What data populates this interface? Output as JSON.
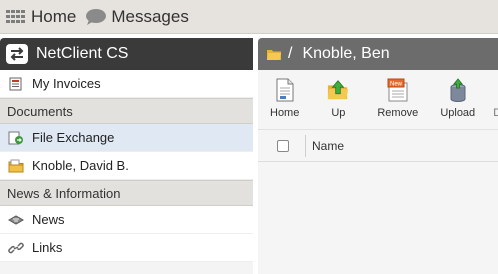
{
  "topnav": {
    "home": "Home",
    "messages": "Messages"
  },
  "sidebar": {
    "app_title": "NetClient CS",
    "items": [
      {
        "type": "item",
        "label": "My Invoices",
        "icon": "invoice-icon"
      },
      {
        "type": "section",
        "label": "Documents"
      },
      {
        "type": "item",
        "label": "File Exchange",
        "icon": "file-exchange-icon",
        "active": true
      },
      {
        "type": "item",
        "label": "Knoble, David B.",
        "icon": "folder-icon"
      },
      {
        "type": "section",
        "label": "News & Information"
      },
      {
        "type": "item",
        "label": "News",
        "icon": "news-icon"
      },
      {
        "type": "item",
        "label": "Links",
        "icon": "link-icon"
      }
    ]
  },
  "main": {
    "breadcrumb_sep": "/",
    "breadcrumb_name": "Knoble, Ben",
    "toolbar": [
      {
        "label": "Home",
        "icon": "document-home-icon"
      },
      {
        "label": "Up",
        "icon": "folder-up-icon"
      },
      {
        "label": "Remove",
        "icon": "remove-new-icon"
      },
      {
        "label": "Upload",
        "icon": "upload-icon"
      },
      {
        "label": "D",
        "icon": "download-icon"
      }
    ],
    "table": {
      "column_name": "Name"
    }
  },
  "colors": {
    "sidebar_header": "#3a3a3a",
    "main_header": "#6c6c6c",
    "active_item": "#dfe8f3",
    "section_bg": "#e3e1de",
    "topbar_bg": "#e6e3df"
  }
}
